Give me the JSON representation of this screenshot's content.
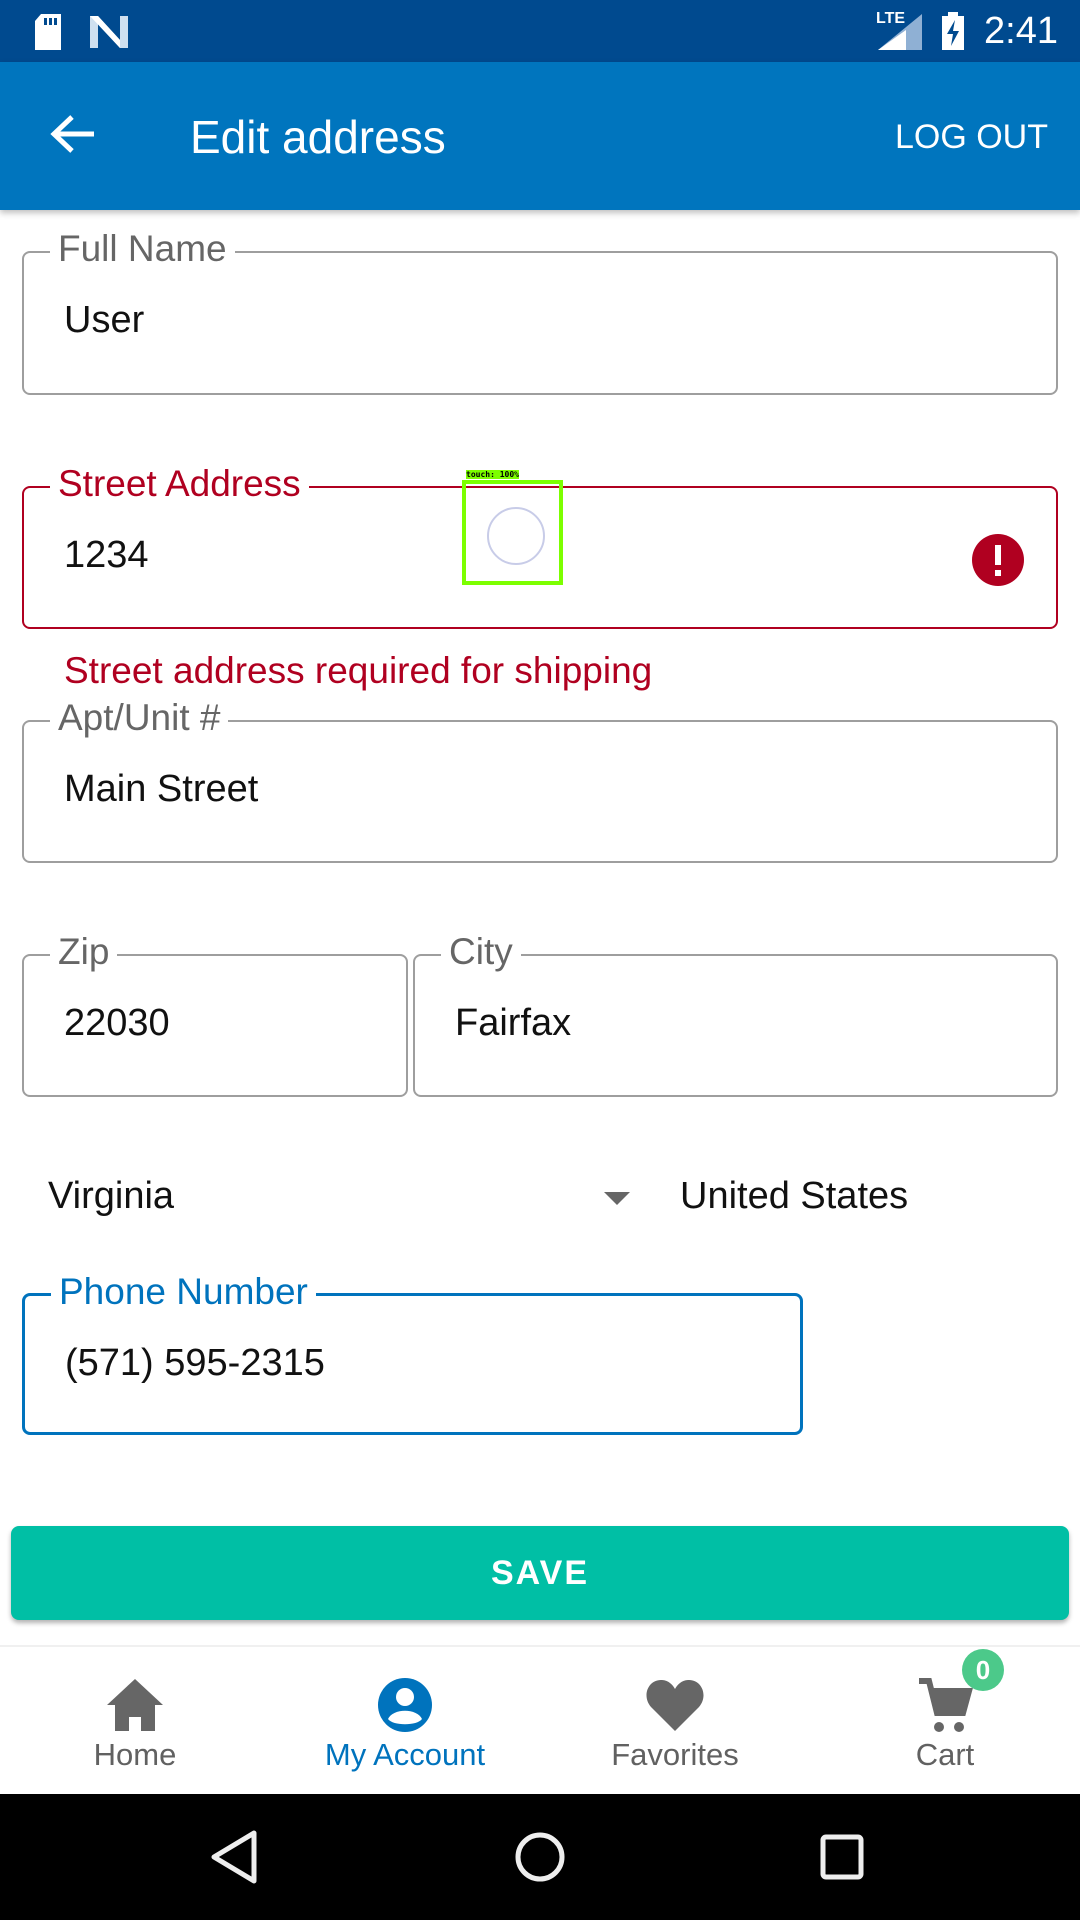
{
  "status_bar": {
    "time": "2:41",
    "network": "LTE",
    "icons": [
      "sd-card-icon",
      "n-logo-icon",
      "lte-signal-icon",
      "battery-charging-icon"
    ]
  },
  "app_bar": {
    "title": "Edit address",
    "logout_label": "LOG OUT",
    "back_icon": "arrow-back-icon"
  },
  "form": {
    "full_name": {
      "label": "Full Name",
      "value": "User"
    },
    "street": {
      "label": "Street Address",
      "value": "1234",
      "error": "Street address required for shipping"
    },
    "apt": {
      "label": "Apt/Unit #",
      "value": "Main Street"
    },
    "zip": {
      "label": "Zip",
      "value": "22030"
    },
    "city": {
      "label": "City",
      "value": "Fairfax"
    },
    "state": {
      "value": "Virginia"
    },
    "country": {
      "value": "United States"
    },
    "phone": {
      "label": "Phone Number",
      "value": "(571) 595-2315"
    }
  },
  "touch_overlay": {
    "label": "touch: 100%"
  },
  "save_label": "SAVE",
  "bottom_nav": {
    "items": [
      {
        "label": "Home",
        "icon": "home-icon"
      },
      {
        "label": "My Account",
        "icon": "account-circle-icon",
        "active": true
      },
      {
        "label": "Favorites",
        "icon": "heart-icon"
      },
      {
        "label": "Cart",
        "icon": "cart-icon",
        "badge": "0"
      }
    ]
  },
  "colors": {
    "primary": "#0075be",
    "status_bar": "#004a8f",
    "error": "#b00020",
    "accent": "#00bfa5",
    "badge": "#4cc98a"
  }
}
